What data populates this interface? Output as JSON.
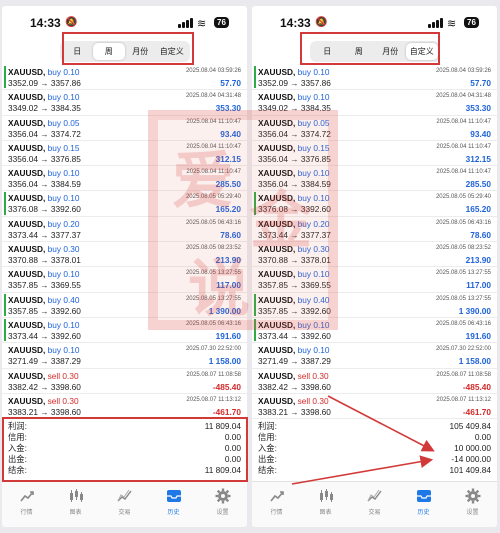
{
  "status": {
    "time": "14:33",
    "battery": "76"
  },
  "segments": [
    "日",
    "周",
    "月份",
    "自定义"
  ],
  "left_active": 1,
  "right_active": 3,
  "trades": [
    {
      "symbol": "XAUUSD,",
      "side": "buy",
      "lot": "0.10",
      "date": "2025.08.04 03:59:26",
      "prices": "3352.09 → 3357.86",
      "profit": "57.70",
      "mark": true
    },
    {
      "symbol": "XAUUSD,",
      "side": "buy",
      "lot": "0.10",
      "date": "2025.08.04 04:31:48",
      "prices": "3349.02 → 3384.35",
      "profit": "353.30",
      "mark": false
    },
    {
      "symbol": "XAUUSD,",
      "side": "buy",
      "lot": "0.05",
      "date": "2025.08.04 11:10:47",
      "prices": "3356.04 → 3374.72",
      "profit": "93.40",
      "mark": false
    },
    {
      "symbol": "XAUUSD,",
      "side": "buy",
      "lot": "0.15",
      "date": "2025.08.04 11:10:47",
      "prices": "3356.04 → 3376.85",
      "profit": "312.15",
      "mark": false
    },
    {
      "symbol": "XAUUSD,",
      "side": "buy",
      "lot": "0.10",
      "date": "2025.08.04 11:10:47",
      "prices": "3356.04 → 3384.59",
      "profit": "285.50",
      "mark": false
    },
    {
      "symbol": "XAUUSD,",
      "side": "buy",
      "lot": "0.10",
      "date": "2025.08.05 05:29:40",
      "prices": "3376.08 → 3392.60",
      "profit": "165.20",
      "mark": true
    },
    {
      "symbol": "XAUUSD,",
      "side": "buy",
      "lot": "0.20",
      "date": "2025.08.05 06:43:16",
      "prices": "3373.44 → 3377.37",
      "profit": "78.60",
      "mark": false
    },
    {
      "symbol": "XAUUSD,",
      "side": "buy",
      "lot": "0.30",
      "date": "2025.08.05 08:23:52",
      "prices": "3370.88 → 3378.01",
      "profit": "213.90",
      "mark": false
    },
    {
      "symbol": "XAUUSD,",
      "side": "buy",
      "lot": "0.10",
      "date": "2025.08.05 13:27:55",
      "prices": "3357.85 → 3369.55",
      "profit": "117.00",
      "mark": false
    },
    {
      "symbol": "XAUUSD,",
      "side": "buy",
      "lot": "0.40",
      "date": "2025.08.05 13:27:55",
      "prices": "3357.85 → 3392.60",
      "profit": "1 390.00",
      "mark": true
    },
    {
      "symbol": "XAUUSD,",
      "side": "buy",
      "lot": "0.10",
      "date": "2025.08.05 06:43:16",
      "prices": "3373.44 → 3392.60",
      "profit": "191.60",
      "mark": true
    },
    {
      "symbol": "XAUUSD,",
      "side": "buy",
      "lot": "0.10",
      "date": "2025.07.30 22:52:00",
      "prices": "3271.49 → 3387.29",
      "profit": "1 158.00",
      "mark": false
    },
    {
      "symbol": "XAUUSD,",
      "side": "sell",
      "lot": "0.30",
      "date": "2025.08.07 11:08:58",
      "prices": "3382.42 → 3398.60",
      "profit": "-485.40",
      "mark": false
    },
    {
      "symbol": "XAUUSD,",
      "side": "sell",
      "lot": "0.30",
      "date": "2025.08.07 11:13:12",
      "prices": "3383.21 → 3398.60",
      "profit": "-461.70",
      "mark": false
    }
  ],
  "summary_labels": [
    "利润:",
    "信用:",
    "入金:",
    "出金:",
    "结余:"
  ],
  "left_summary": [
    "11 809.04",
    "0.00",
    "0.00",
    "0.00",
    "11 809.04"
  ],
  "right_summary": [
    "105 409.84",
    "0.00",
    "10 000.00",
    "-14 000.00",
    "101 409.84"
  ],
  "tabs": [
    {
      "label": "行情",
      "icon": "quotes-icon"
    },
    {
      "label": "图表",
      "icon": "chart-icon"
    },
    {
      "label": "交易",
      "icon": "trade-icon"
    },
    {
      "label": "历史",
      "icon": "history-icon"
    },
    {
      "label": "设置",
      "icon": "settings-icon"
    }
  ],
  "active_tab": 3,
  "watermark_text": [
    "爱",
    "金",
    "说"
  ],
  "colors": {
    "buy": "#1e62d9",
    "sell": "#d42a2a",
    "accent": "#1e78e6",
    "annotation": "#d23a3a",
    "marker": "#2eaa46"
  }
}
